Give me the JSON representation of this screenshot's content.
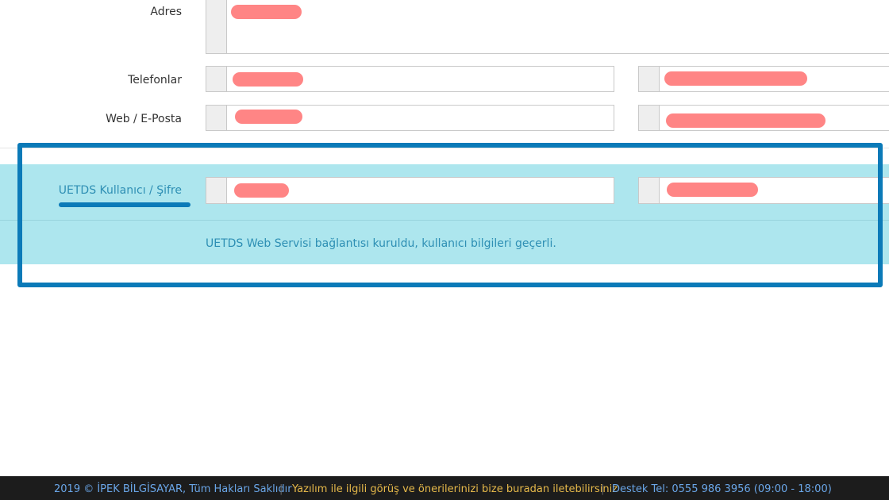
{
  "form": {
    "address": {
      "label": "Adres"
    },
    "phones": {
      "label": "Telefonlar"
    },
    "web_email": {
      "label": "Web / E-Posta"
    }
  },
  "uetds": {
    "label": "UETDS Kullanıcı / Şifre",
    "status_message": "UETDS Web Servisi bağlantısı kuruldu, kullanıcı bilgileri geçerli."
  },
  "footer": {
    "copyright": "2019 © İPEK BİLGİSAYAR, Tüm Hakları Saklıdır",
    "separator": "|",
    "feedback_link": "Yazılım ile ilgili görüş ve önerilerinizi bize buradan iletebilirsiniz",
    "support": "Destek Tel: 0555 986 3956 (09:00 - 18:00)"
  },
  "colors": {
    "highlight": "#0b7ab8",
    "band": "#ade6ee",
    "redaction": "#ff8585",
    "footer_bg": "#1c1c1c"
  }
}
